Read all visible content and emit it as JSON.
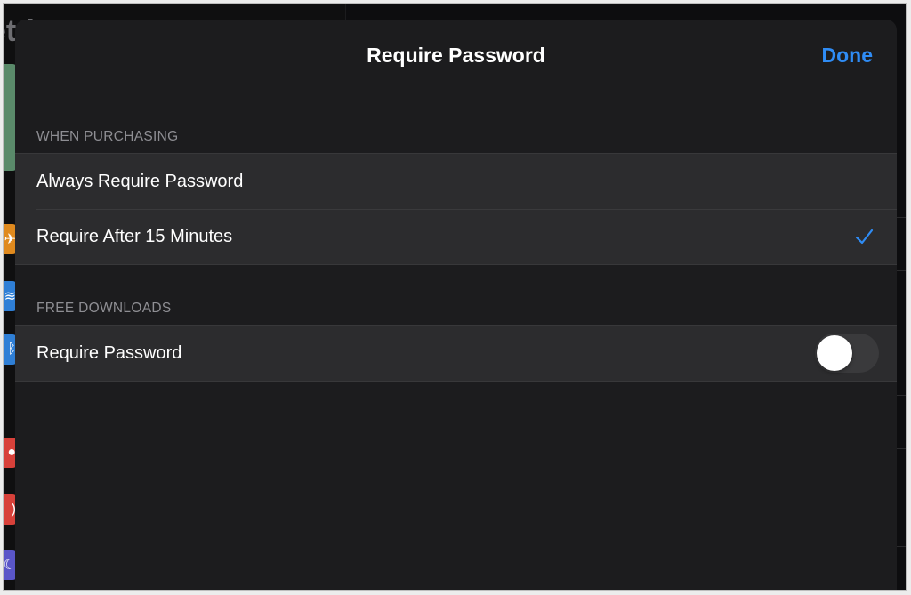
{
  "background": {
    "partial_title": "etti"
  },
  "nav": {
    "title": "Require Password",
    "done_label": "Done"
  },
  "sections": {
    "purchasing": {
      "header": "WHEN PURCHASING",
      "options": [
        {
          "label": "Always Require Password",
          "selected": false
        },
        {
          "label": "Require After 15 Minutes",
          "selected": true
        }
      ]
    },
    "free_downloads": {
      "header": "FREE DOWNLOADS",
      "require_password": {
        "label": "Require Password",
        "enabled": false
      }
    }
  },
  "colors": {
    "accent": "#2f8cf5",
    "sheet_bg": "#1c1c1e",
    "row_bg": "#2c2c2e",
    "toggle_off": "#3a3a3c"
  }
}
